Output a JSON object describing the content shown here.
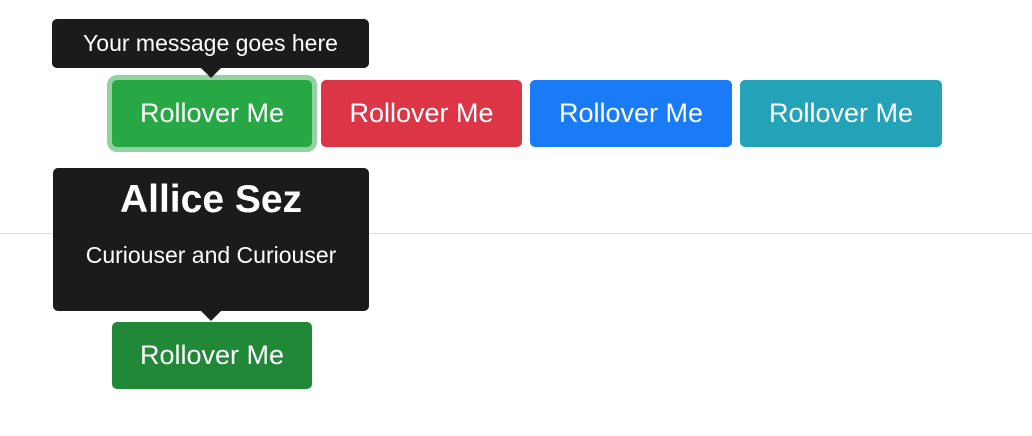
{
  "tooltip_simple": {
    "text": "Your message goes here"
  },
  "tooltip_rich": {
    "title": "Allice Sez",
    "body": "Curiouser and Curiouser"
  },
  "buttons_row1": [
    {
      "label": "Rollover Me",
      "color": "#28a745",
      "state": "focused"
    },
    {
      "label": "Rollover Me",
      "color": "#dc3545"
    },
    {
      "label": "Rollover Me",
      "color": "#1a7bf7"
    },
    {
      "label": "Rollover Me",
      "color": "#23a2b8"
    }
  ],
  "buttons_row2": [
    {
      "label": "Rollover Me",
      "color": "#218838"
    }
  ],
  "tooltip_color": "#1b1b1b"
}
